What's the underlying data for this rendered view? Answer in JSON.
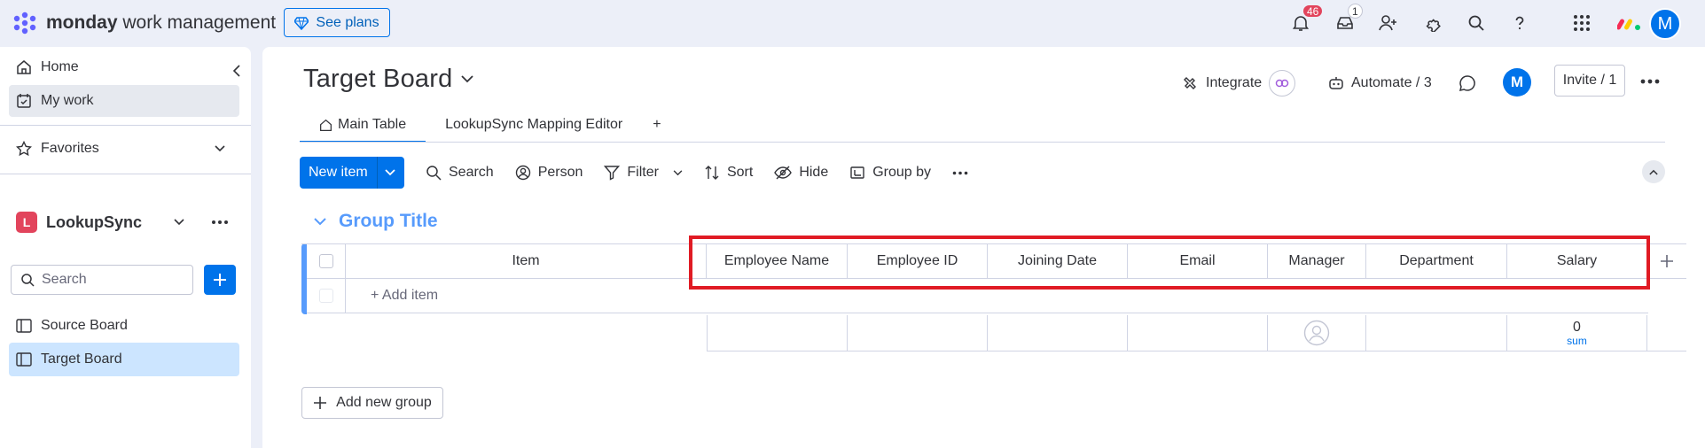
{
  "app": {
    "brand_bold": "monday",
    "brand_rest": " work management",
    "see_plans_label": "See plans",
    "notifications_count": "46",
    "inbox_count": "1",
    "avatar_letter": "M",
    "icons": [
      "gem-icon",
      "bell-icon",
      "inbox-icon",
      "invite-user-icon",
      "puzzle-icon",
      "search-icon",
      "help-icon",
      "apps-grid-icon"
    ]
  },
  "sidebar": {
    "home_label": "Home",
    "mywork_label": "My work",
    "favorites_label": "Favorites",
    "workspace_letter": "L",
    "workspace_name": "LookupSync",
    "search_placeholder": "Search",
    "boards": [
      {
        "label": "Source Board"
      },
      {
        "label": "Target Board"
      }
    ]
  },
  "board": {
    "title": "Target Board",
    "integrate_label": "Integrate",
    "automate_label": "Automate / 3",
    "avatar_letter": "M",
    "invite_label": "Invite / 1",
    "tabs": [
      {
        "label": "Main Table"
      },
      {
        "label": "LookupSync Mapping Editor"
      }
    ],
    "add_tab_label": "+",
    "toolbar": {
      "new_item_label": "New item",
      "search_label": "Search",
      "person_label": "Person",
      "filter_label": "Filter",
      "sort_label": "Sort",
      "hide_label": "Hide",
      "group_by_label": "Group by"
    },
    "group": {
      "title": "Group Title",
      "columns": [
        "Item",
        "Employee Name",
        "Employee ID",
        "Joining Date",
        "Email",
        "Manager",
        "Department",
        "Salary"
      ],
      "add_item_label": "+ Add item",
      "summary": {
        "salary_value": "0",
        "salary_label": "sum"
      }
    },
    "add_group_label": "Add new group"
  },
  "colors": {
    "accent": "#0073ea",
    "group": "#579bfc",
    "highlight": "#e01b24",
    "badge": "#e2445c"
  }
}
